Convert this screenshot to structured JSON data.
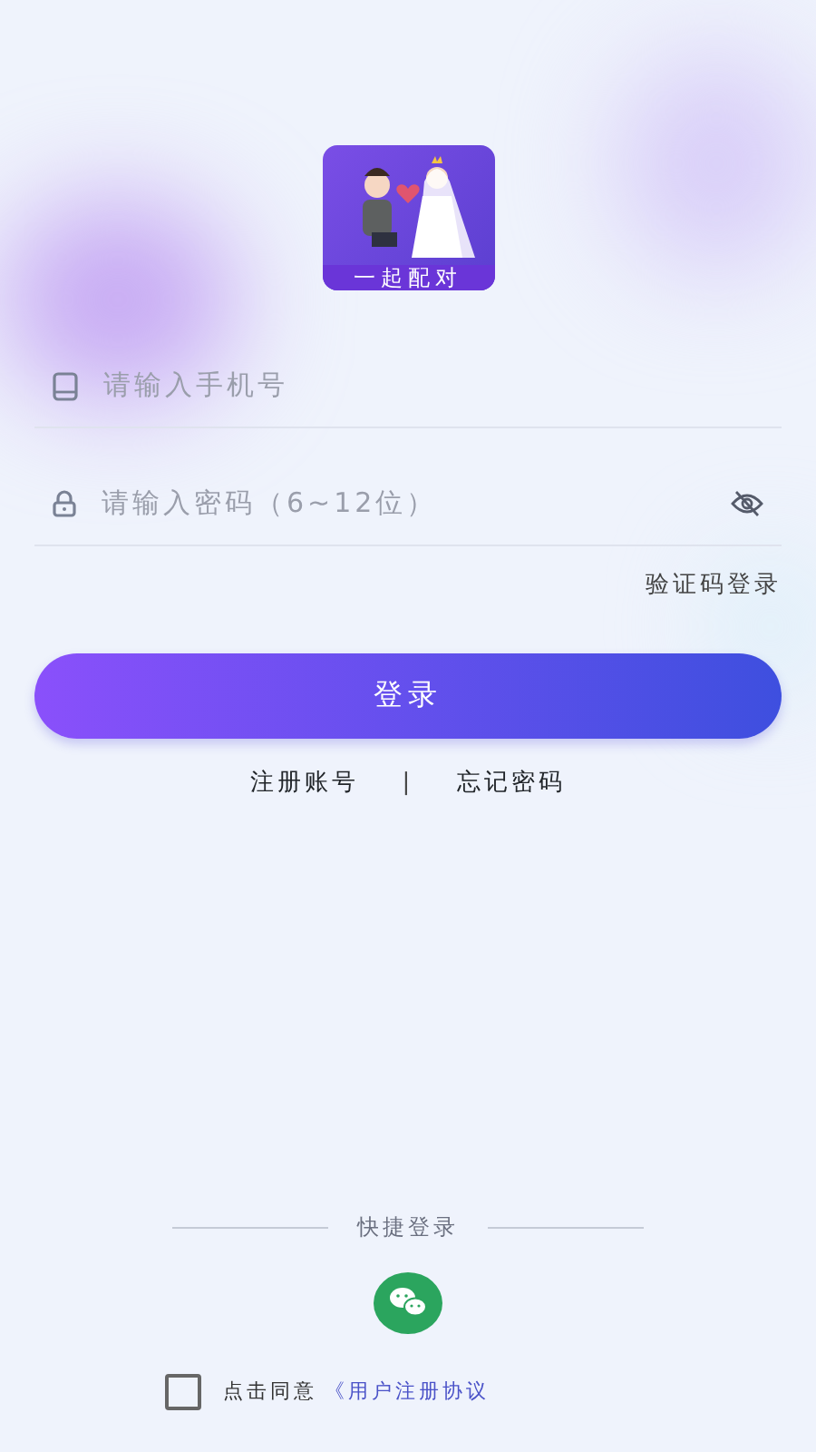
{
  "logo": {
    "caption": "一起配对"
  },
  "phone_field": {
    "placeholder": "请输入手机号"
  },
  "password_field": {
    "placeholder": "请输入密码（6~12位）",
    "password_visible": false
  },
  "sms_login_link": "验证码登录",
  "login_button": "登录",
  "links": [
    "注册账号",
    "|",
    "忘记密码"
  ],
  "quick_login": {
    "title": "快捷登录"
  },
  "agreement": {
    "checked": false,
    "text": "点击同意",
    "link": "《用户注册协议"
  }
}
